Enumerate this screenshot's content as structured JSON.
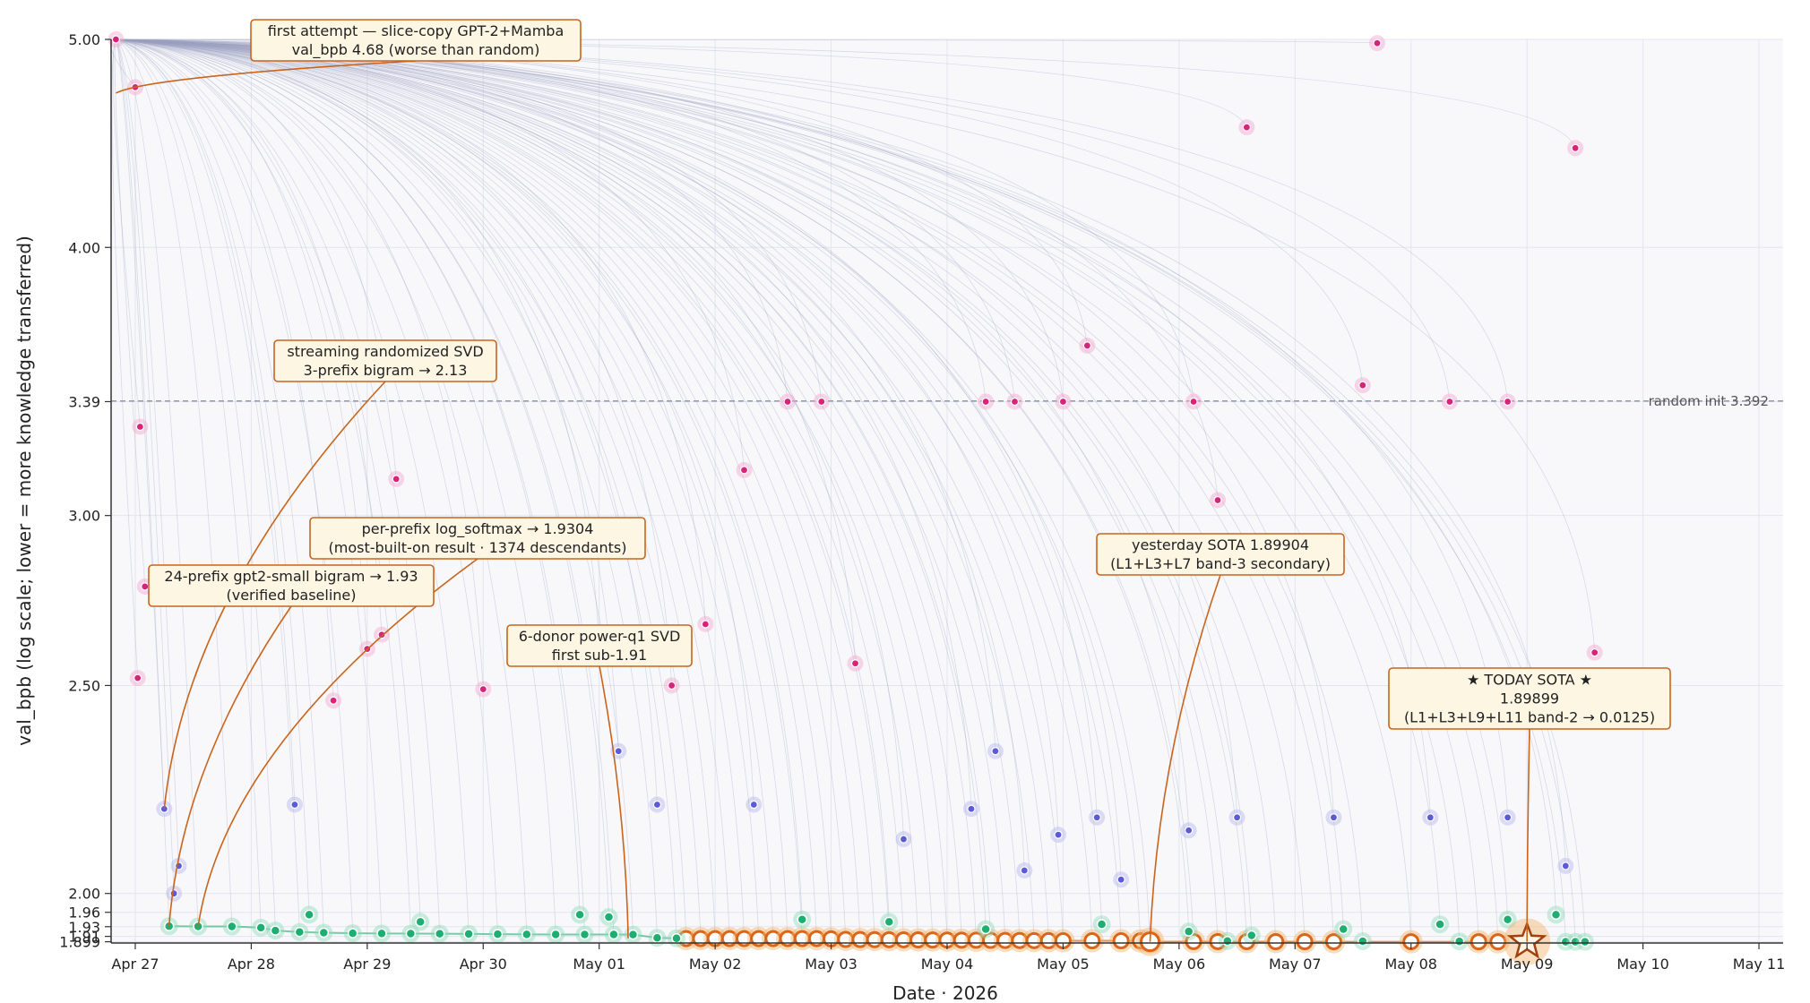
{
  "chart_data": {
    "type": "scatter",
    "title": "",
    "xlabel": "Date  ·  2026",
    "ylabel": "val_bpb (log scale; lower = more knowledge transferred)",
    "y_scale": "log",
    "ylim": [
      1.8965,
      5.0
    ],
    "xlim": [
      "2026-04-26T19:00",
      "2026-05-11T05:00"
    ],
    "grid": true,
    "x_ticks": [
      "Apr 27",
      "Apr 28",
      "Apr 29",
      "Apr 30",
      "May 01",
      "May 02",
      "May 03",
      "May 04",
      "May 05",
      "May 06",
      "May 07",
      "May 08",
      "May 09",
      "May 10",
      "May 11"
    ],
    "x_tick_dates": [
      "2026-04-27",
      "2026-04-28",
      "2026-04-29",
      "2026-04-30",
      "2026-05-01",
      "2026-05-02",
      "2026-05-03",
      "2026-05-04",
      "2026-05-05",
      "2026-05-06",
      "2026-05-07",
      "2026-05-08",
      "2026-05-09",
      "2026-05-10",
      "2026-05-11"
    ],
    "y_ticks": [
      1.899,
      1.91,
      1.93,
      1.96,
      2.0,
      2.5,
      3.0,
      3.39,
      4.0,
      5.0
    ],
    "y_tick_labels": [
      "1.899",
      "1.91",
      "1.93",
      "1.96",
      "2.00",
      "2.50",
      "3.00",
      "3.39",
      "4.00",
      "5.00"
    ],
    "reference_line": {
      "y": 3.392,
      "label": "random init  3.392"
    },
    "colors": {
      "background": "#f8f8fb",
      "sota_orange": "#d9661a",
      "sota_fill": "#ffffff",
      "good_green": "#1fae72",
      "mid_blue": "#3aa0d8",
      "mid_indigo": "#5b5bd6",
      "bad_pink": "#d8237a",
      "lineage": "#9aa0c0",
      "annotation_edge": "#c8641c",
      "annotation_fill": "#fdf6e3"
    },
    "series": [
      {
        "name": "",
        "role": "lineage frontier (orange rings)",
        "points": [
          {
            "x": "2026-05-01T18:00",
            "y": 1.9055
          },
          {
            "x": "2026-05-01T21:00",
            "y": 1.9055
          },
          {
            "x": "2026-05-02T00:00",
            "y": 1.9055
          },
          {
            "x": "2026-05-02T03:00",
            "y": 1.9055
          },
          {
            "x": "2026-05-02T06:00",
            "y": 1.9055
          },
          {
            "x": "2026-05-02T09:00",
            "y": 1.9055
          },
          {
            "x": "2026-05-02T12:00",
            "y": 1.9055
          },
          {
            "x": "2026-05-02T15:00",
            "y": 1.9055
          },
          {
            "x": "2026-05-02T18:00",
            "y": 1.9055
          },
          {
            "x": "2026-05-02T21:00",
            "y": 1.9055
          },
          {
            "x": "2026-05-03T00:00",
            "y": 1.905
          },
          {
            "x": "2026-05-03T03:00",
            "y": 1.9038
          },
          {
            "x": "2026-05-03T06:00",
            "y": 1.9036
          },
          {
            "x": "2026-05-03T09:00",
            "y": 1.9034
          },
          {
            "x": "2026-05-03T12:00",
            "y": 1.9032
          },
          {
            "x": "2026-05-03T15:00",
            "y": 1.903
          },
          {
            "x": "2026-05-03T18:00",
            "y": 1.9028
          },
          {
            "x": "2026-05-03T21:00",
            "y": 1.9027
          },
          {
            "x": "2026-05-04T00:00",
            "y": 1.9025
          },
          {
            "x": "2026-05-04T03:00",
            "y": 1.9023
          },
          {
            "x": "2026-05-04T06:00",
            "y": 1.9021
          },
          {
            "x": "2026-05-04T09:00",
            "y": 1.902
          },
          {
            "x": "2026-05-04T12:00",
            "y": 1.9018
          },
          {
            "x": "2026-05-04T15:00",
            "y": 1.9016
          },
          {
            "x": "2026-05-04T18:00",
            "y": 1.9014
          },
          {
            "x": "2026-05-04T21:00",
            "y": 1.9012
          },
          {
            "x": "2026-05-05T00:00",
            "y": 1.901
          },
          {
            "x": "2026-05-05T06:00",
            "y": 1.901
          },
          {
            "x": "2026-05-05T12:00",
            "y": 1.901
          },
          {
            "x": "2026-05-05T16:00",
            "y": 1.9008
          },
          {
            "x": "2026-05-05T18:00",
            "y": 1.89904
          },
          {
            "x": "2026-05-06T03:00",
            "y": 1.8995
          },
          {
            "x": "2026-05-06T08:00",
            "y": 1.8993
          },
          {
            "x": "2026-05-06T14:00",
            "y": 1.8993
          },
          {
            "x": "2026-05-06T20:00",
            "y": 1.8992
          },
          {
            "x": "2026-05-07T02:00",
            "y": 1.8992
          },
          {
            "x": "2026-05-07T08:00",
            "y": 1.8991
          },
          {
            "x": "2026-05-08T00:00",
            "y": 1.8991
          },
          {
            "x": "2026-05-08T14:00",
            "y": 1.899
          },
          {
            "x": "2026-05-08T18:00",
            "y": 1.899
          }
        ]
      },
      {
        "name": "",
        "role": "good runs (green)",
        "points": [
          {
            "x": "2026-04-27T07:00",
            "y": 1.931
          },
          {
            "x": "2026-04-27T13:00",
            "y": 1.9305
          },
          {
            "x": "2026-04-27T20:00",
            "y": 1.9304
          },
          {
            "x": "2026-04-28T02:00",
            "y": 1.928
          },
          {
            "x": "2026-04-28T05:00",
            "y": 1.922
          },
          {
            "x": "2026-04-28T10:00",
            "y": 1.919
          },
          {
            "x": "2026-04-28T15:00",
            "y": 1.9175
          },
          {
            "x": "2026-04-28T21:00",
            "y": 1.9165
          },
          {
            "x": "2026-04-29T03:00",
            "y": 1.916
          },
          {
            "x": "2026-04-29T09:00",
            "y": 1.9158
          },
          {
            "x": "2026-04-29T15:00",
            "y": 1.9155
          },
          {
            "x": "2026-04-29T21:00",
            "y": 1.915
          },
          {
            "x": "2026-04-30T03:00",
            "y": 1.9145
          },
          {
            "x": "2026-04-30T09:00",
            "y": 1.9142
          },
          {
            "x": "2026-04-30T15:00",
            "y": 1.914
          },
          {
            "x": "2026-04-30T21:00",
            "y": 1.9139
          },
          {
            "x": "2026-05-01T03:00",
            "y": 1.9138
          },
          {
            "x": "2026-05-01T07:00",
            "y": 1.9137
          },
          {
            "x": "2026-05-01T12:00",
            "y": 1.907
          },
          {
            "x": "2026-05-01T16:00",
            "y": 1.906
          },
          {
            "x": "2026-04-28T12:00",
            "y": 1.955
          },
          {
            "x": "2026-04-29T11:00",
            "y": 1.94
          },
          {
            "x": "2026-04-30T20:00",
            "y": 1.955
          },
          {
            "x": "2026-05-01T02:00",
            "y": 1.95
          },
          {
            "x": "2026-05-02T18:00",
            "y": 1.945
          },
          {
            "x": "2026-05-03T12:00",
            "y": 1.94
          },
          {
            "x": "2026-05-04T08:00",
            "y": 1.925
          },
          {
            "x": "2026-05-05T08:00",
            "y": 1.935
          },
          {
            "x": "2026-05-06T02:00",
            "y": 1.92
          },
          {
            "x": "2026-05-06T15:00",
            "y": 1.912
          },
          {
            "x": "2026-05-07T10:00",
            "y": 1.925
          },
          {
            "x": "2026-05-08T06:00",
            "y": 1.935
          },
          {
            "x": "2026-05-08T20:00",
            "y": 1.945
          },
          {
            "x": "2026-05-09T06:00",
            "y": 1.955
          },
          {
            "x": "2026-05-06T10:00",
            "y": 1.9005
          },
          {
            "x": "2026-05-07T14:00",
            "y": 1.9002
          },
          {
            "x": "2026-05-08T10:00",
            "y": 1.8998
          },
          {
            "x": "2026-05-09T08:00",
            "y": 1.899
          },
          {
            "x": "2026-05-09T10:00",
            "y": 1.899
          },
          {
            "x": "2026-05-09T12:00",
            "y": 1.899
          }
        ]
      },
      {
        "name": "",
        "role": "intermediate runs (blue / indigo)",
        "points": [
          {
            "x": "2026-04-27T06:00",
            "y": 2.19
          },
          {
            "x": "2026-04-27T08:00",
            "y": 2.0
          },
          {
            "x": "2026-04-27T09:00",
            "y": 2.06
          },
          {
            "x": "2026-04-28T09:00",
            "y": 2.2
          },
          {
            "x": "2026-05-01T04:00",
            "y": 2.33
          },
          {
            "x": "2026-05-01T12:00",
            "y": 2.2
          },
          {
            "x": "2026-05-02T08:00",
            "y": 2.2
          },
          {
            "x": "2026-05-03T15:00",
            "y": 2.12
          },
          {
            "x": "2026-05-04T05:00",
            "y": 2.19
          },
          {
            "x": "2026-05-04T10:00",
            "y": 2.33
          },
          {
            "x": "2026-05-04T16:00",
            "y": 2.05
          },
          {
            "x": "2026-05-04T23:00",
            "y": 2.13
          },
          {
            "x": "2026-05-05T07:00",
            "y": 2.17
          },
          {
            "x": "2026-05-05T12:00",
            "y": 2.03
          },
          {
            "x": "2026-05-06T02:00",
            "y": 2.14
          },
          {
            "x": "2026-05-06T12:00",
            "y": 2.17
          },
          {
            "x": "2026-05-07T08:00",
            "y": 2.17
          },
          {
            "x": "2026-05-08T04:00",
            "y": 2.17
          },
          {
            "x": "2026-05-08T20:00",
            "y": 2.17
          },
          {
            "x": "2026-05-09T08:00",
            "y": 2.06
          }
        ]
      },
      {
        "name": "",
        "role": "poor runs (pink / magenta)",
        "points": [
          {
            "x": "2026-04-26T20:00",
            "y": 5.0
          },
          {
            "x": "2026-04-27T00:00",
            "y": 4.75
          },
          {
            "x": "2026-04-27T01:00",
            "y": 3.3
          },
          {
            "x": "2026-04-27T02:00",
            "y": 2.78
          },
          {
            "x": "2026-04-27T00:30",
            "y": 2.52
          },
          {
            "x": "2026-04-28T17:00",
            "y": 2.46
          },
          {
            "x": "2026-04-29T00:00",
            "y": 2.6
          },
          {
            "x": "2026-04-29T03:00",
            "y": 2.64
          },
          {
            "x": "2026-04-29T06:00",
            "y": 3.12
          },
          {
            "x": "2026-04-30T00:00",
            "y": 2.49
          },
          {
            "x": "2026-05-01T00:00",
            "y": 2.62
          },
          {
            "x": "2026-05-01T15:00",
            "y": 2.5
          },
          {
            "x": "2026-05-01T22:00",
            "y": 2.67
          },
          {
            "x": "2026-05-02T06:00",
            "y": 3.15
          },
          {
            "x": "2026-05-02T15:00",
            "y": 3.39
          },
          {
            "x": "2026-05-02T22:00",
            "y": 3.39
          },
          {
            "x": "2026-05-03T05:00",
            "y": 2.56
          },
          {
            "x": "2026-05-04T08:00",
            "y": 3.39
          },
          {
            "x": "2026-05-04T14:00",
            "y": 3.39
          },
          {
            "x": "2026-05-05T00:00",
            "y": 3.39
          },
          {
            "x": "2026-05-05T05:00",
            "y": 3.6
          },
          {
            "x": "2026-05-06T03:00",
            "y": 3.39
          },
          {
            "x": "2026-05-06T08:00",
            "y": 3.05
          },
          {
            "x": "2026-05-06T14:00",
            "y": 4.55
          },
          {
            "x": "2026-05-07T14:00",
            "y": 3.45
          },
          {
            "x": "2026-05-07T17:00",
            "y": 4.98
          },
          {
            "x": "2026-05-08T08:00",
            "y": 3.39
          },
          {
            "x": "2026-05-08T20:00",
            "y": 3.39
          },
          {
            "x": "2026-05-09T10:00",
            "y": 4.45
          },
          {
            "x": "2026-05-09T14:00",
            "y": 2.59
          }
        ]
      }
    ],
    "highlights": [
      {
        "x": "2026-05-05T18:00",
        "y": 1.89904,
        "marker": "ring"
      },
      {
        "x": "2026-05-09T00:00",
        "y": 1.89899,
        "marker": "star"
      }
    ],
    "annotations": [
      {
        "lines": [
          "first attempt — slice-copy GPT-2+Mamba",
          "val_bpb 4.68 (worse than random)"
        ],
        "target_x": "2026-04-26T20:00",
        "target_y": 4.72,
        "anchor": "top-left"
      },
      {
        "lines": [
          "streaming randomized SVD",
          "3-prefix bigram → 2.13"
        ],
        "target_x": "2026-04-27T06:00",
        "target_y": 2.19,
        "anchor": "upper-left"
      },
      {
        "lines": [
          "per-prefix log_softmax → 1.9304",
          "(most-built-on result · 1374 descendants)"
        ],
        "target_x": "2026-04-27T13:00",
        "target_y": 1.9304,
        "anchor": "middle-left"
      },
      {
        "lines": [
          "24-prefix gpt2-small bigram → 1.93",
          "(verified baseline)"
        ],
        "target_x": "2026-04-27T07:00",
        "target_y": 1.931,
        "anchor": "middle-left"
      },
      {
        "lines": [
          "6-donor power-q1 SVD",
          "first sub-1.91"
        ],
        "target_x": "2026-05-01T06:00",
        "target_y": 1.906,
        "anchor": "middle"
      },
      {
        "lines": [
          "yesterday SOTA  1.89904",
          "(L1+L3+L7 band-3 secondary)"
        ],
        "target_x": "2026-05-05T18:00",
        "target_y": 1.89904,
        "anchor": "middle-right"
      },
      {
        "lines": [
          "★ TODAY SOTA ★",
          "1.89899",
          "(L1+L3+L9+L11 band-2 → 0.0125)"
        ],
        "target_x": "2026-05-09T00:00",
        "target_y": 1.89899,
        "anchor": "lower-right"
      }
    ]
  }
}
